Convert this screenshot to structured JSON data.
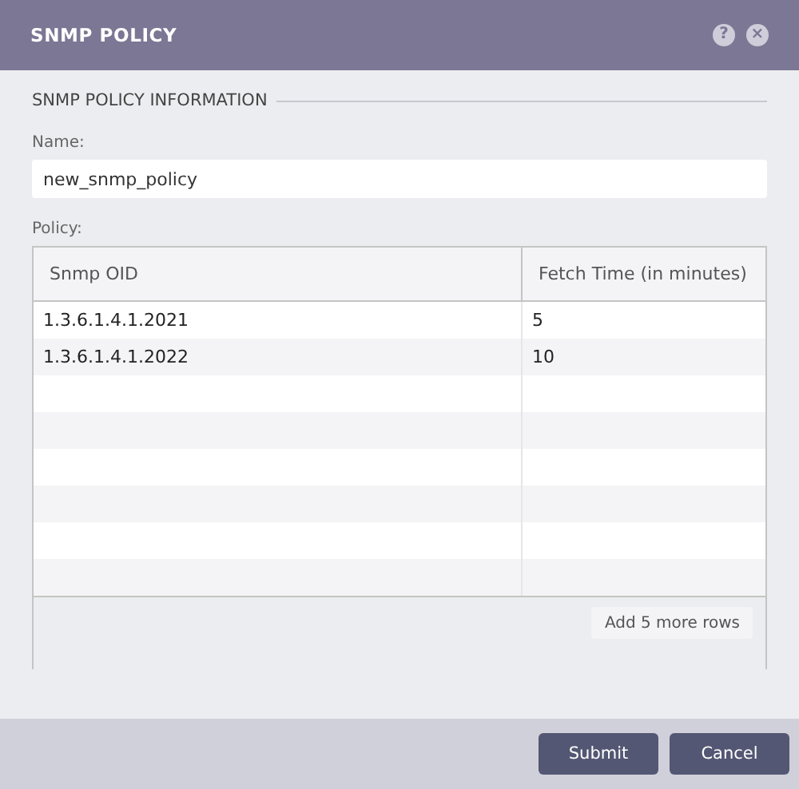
{
  "dialog": {
    "title": "SNMP POLICY",
    "help_button": "?",
    "close_button": "×"
  },
  "section": {
    "title": "SNMP POLICY INFORMATION"
  },
  "name_field": {
    "label": "Name:",
    "value": "new_snmp_policy"
  },
  "policy": {
    "label": "Policy:",
    "columns": [
      "Snmp OID",
      "Fetch Time (in minutes)"
    ],
    "rows": [
      {
        "oid": "1.3.6.1.4.1.2021",
        "fetch_time": "5"
      },
      {
        "oid": "1.3.6.1.4.1.2022",
        "fetch_time": "10"
      },
      {},
      {},
      {},
      {},
      {},
      {}
    ],
    "add_rows_button": "Add 5 more rows"
  },
  "buttons": [
    "Submit",
    "Cancel"
  ]
}
